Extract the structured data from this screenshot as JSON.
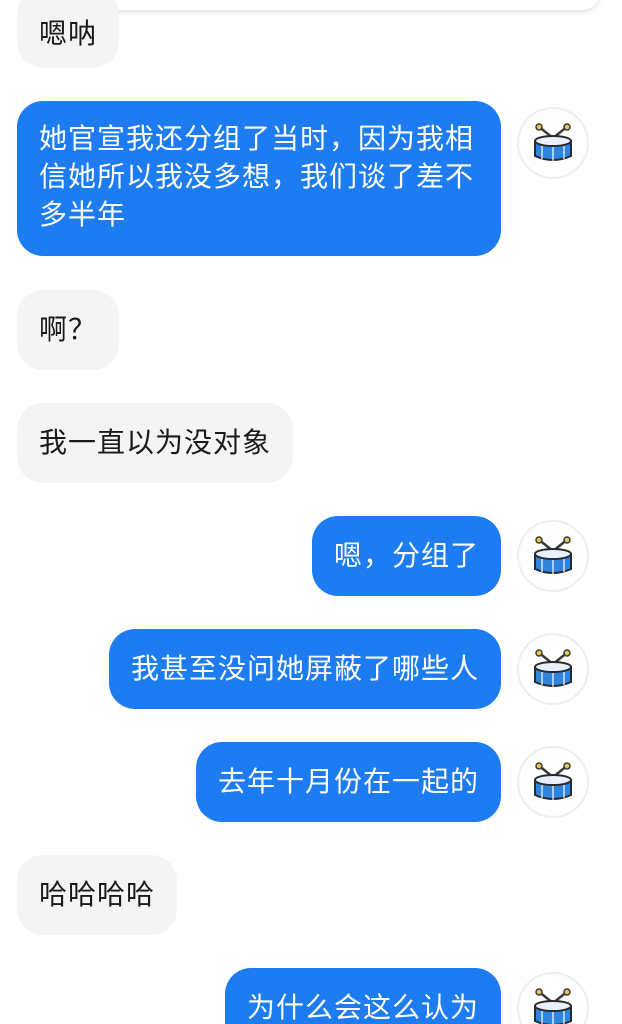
{
  "chat": {
    "messages": [
      {
        "side": "in",
        "text": "嗯呐"
      },
      {
        "side": "out",
        "text": "她官宣我还分组了当时，因为我相信她所以我没多想，我们谈了差不多半年"
      },
      {
        "side": "in",
        "text": "啊？"
      },
      {
        "side": "in",
        "text": "我一直以为没对象"
      },
      {
        "side": "out",
        "text": "嗯，分组了"
      },
      {
        "side": "out",
        "text": "我甚至没问她屏蔽了哪些人"
      },
      {
        "side": "out",
        "text": "去年十月份在一起的"
      },
      {
        "side": "in",
        "text": "哈哈哈哈"
      },
      {
        "side": "out",
        "text": "为什么会这么认为"
      }
    ]
  },
  "colors": {
    "outgoing_bubble": "#1d7cf2",
    "incoming_bubble": "#f4f4f4",
    "avatar_drum": "#2f84e0"
  },
  "avatar": {
    "icon": "drum-icon"
  }
}
